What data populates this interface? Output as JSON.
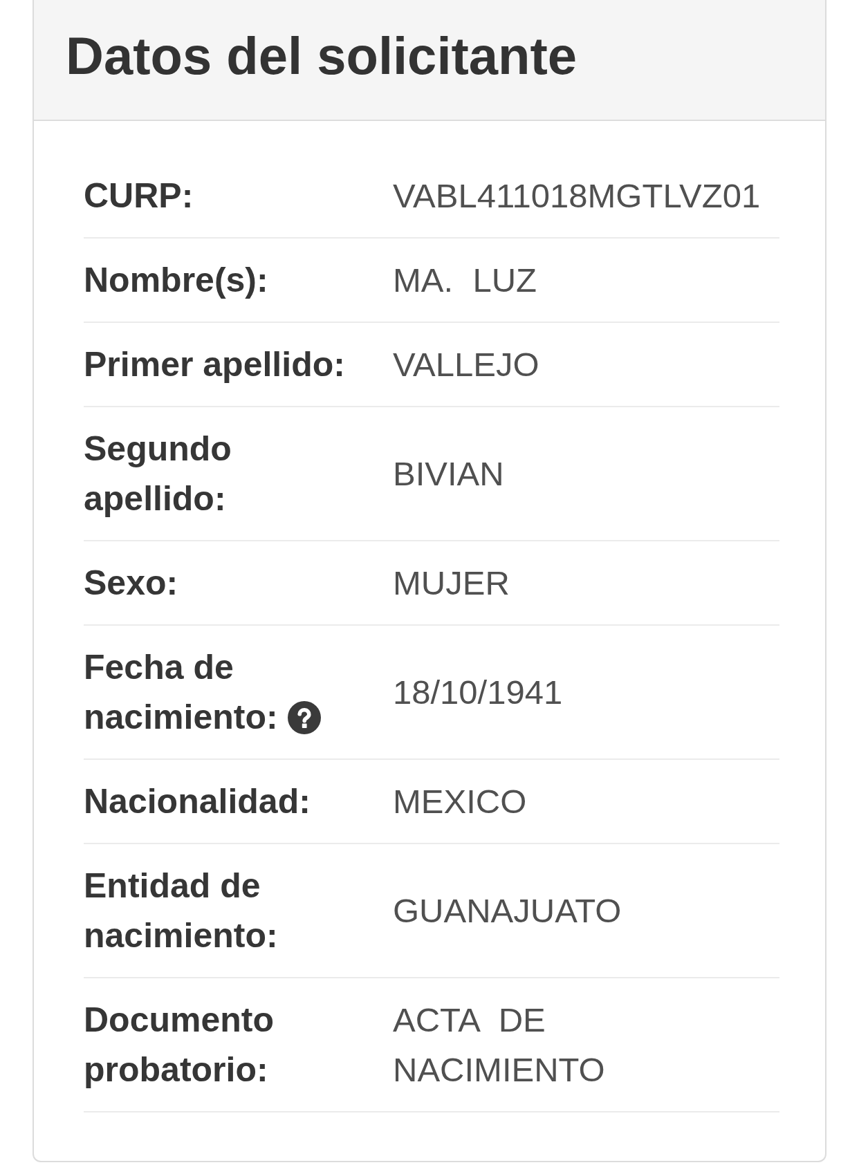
{
  "panel": {
    "title": "Datos del solicitante",
    "rows": [
      {
        "label": "CURP:",
        "value": "VABL411018MGTLVZ01",
        "help": false
      },
      {
        "label": "Nombre(s):",
        "value": "MA. LUZ",
        "help": false
      },
      {
        "label": "Primer apellido:",
        "value": "VALLEJO",
        "help": false
      },
      {
        "label": "Segundo apellido:",
        "value": "BIVIAN",
        "help": false
      },
      {
        "label": "Sexo:",
        "value": "MUJER",
        "help": false
      },
      {
        "label": "Fecha de nacimiento:",
        "value": "18/10/1941",
        "help": true
      },
      {
        "label": "Nacionalidad:",
        "value": "MEXICO",
        "help": false
      },
      {
        "label": "Entidad de nacimiento:",
        "value": "GUANAJUATO",
        "help": false
      },
      {
        "label": "Documento probatorio:",
        "value": "ACTA DE NACIMIENTO",
        "help": false
      }
    ]
  }
}
